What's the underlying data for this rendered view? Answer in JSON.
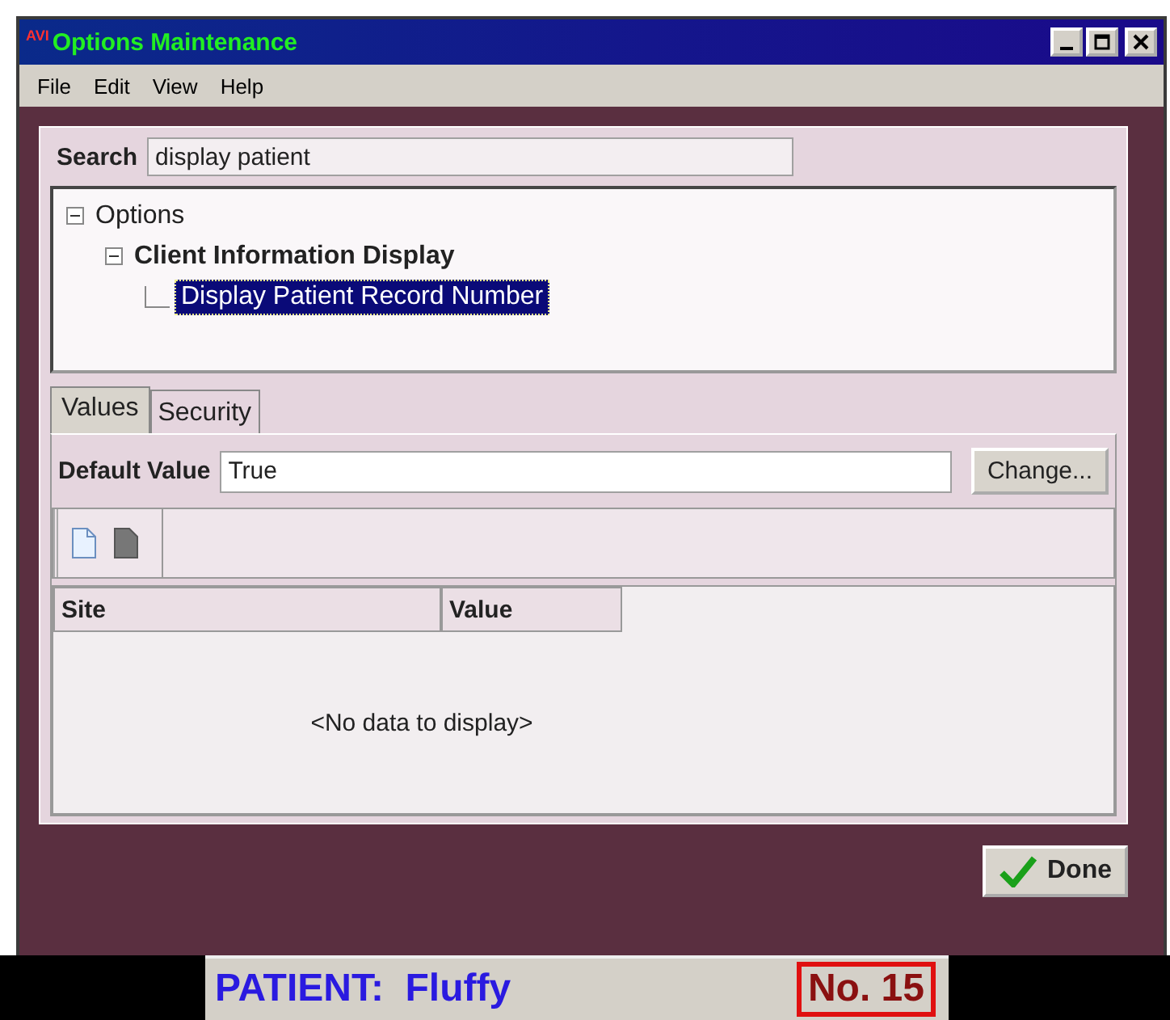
{
  "window": {
    "logo": "AVI",
    "title": "Options Maintenance"
  },
  "menu": [
    "File",
    "Edit",
    "View",
    "Help"
  ],
  "search": {
    "label": "Search",
    "value": "display patient"
  },
  "tree": [
    {
      "label": "Options",
      "expanded": true,
      "selected": false,
      "bold": false,
      "children": [
        {
          "label": "Client Information Display",
          "expanded": true,
          "selected": false,
          "bold": true,
          "children": [
            {
              "label": "Display Patient Record Number",
              "selected": true,
              "bold": false
            }
          ]
        }
      ]
    }
  ],
  "tabs": [
    {
      "label": "Values",
      "selected": true
    },
    {
      "label": "Security",
      "selected": false
    }
  ],
  "default_value": {
    "label": "Default Value",
    "value": "True",
    "button": "Change..."
  },
  "grid": {
    "columns": [
      "Site",
      "Value"
    ],
    "empty": "<No data to display>"
  },
  "done_button": "Done",
  "patient_bar": {
    "patient": "PATIENT:  Fluffy",
    "number": "No. 15"
  }
}
